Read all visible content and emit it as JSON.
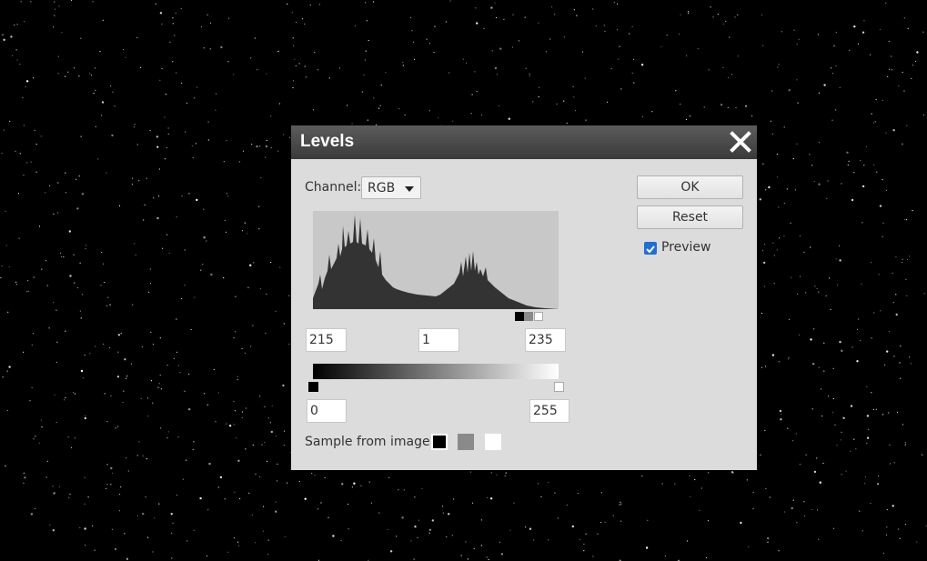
{
  "dialog": {
    "title": "Levels",
    "channel_label": "Channel:",
    "channel_value": "RGB",
    "ok_label": "OK",
    "reset_label": "Reset",
    "preview_label": "Preview",
    "preview_checked": true,
    "input_black": "215",
    "input_gamma": "1",
    "input_white": "235",
    "output_black": "0",
    "output_white": "255",
    "sample_label": "Sample from image:"
  },
  "colors": {
    "dialog_bg": "#dcdcdc",
    "titlebar": "#444444",
    "histogram_bg": "#c8c8c8",
    "histogram_fill": "#333333",
    "accent_checkbox": "#1e6fd9",
    "swatch_black": "#000000",
    "swatch_gray": "#8a8a8a",
    "swatch_white": "#ffffff"
  },
  "icons": {
    "close": "close-x-icon",
    "dropdown": "chevron-down-icon",
    "checkbox": "checkmark-icon"
  }
}
